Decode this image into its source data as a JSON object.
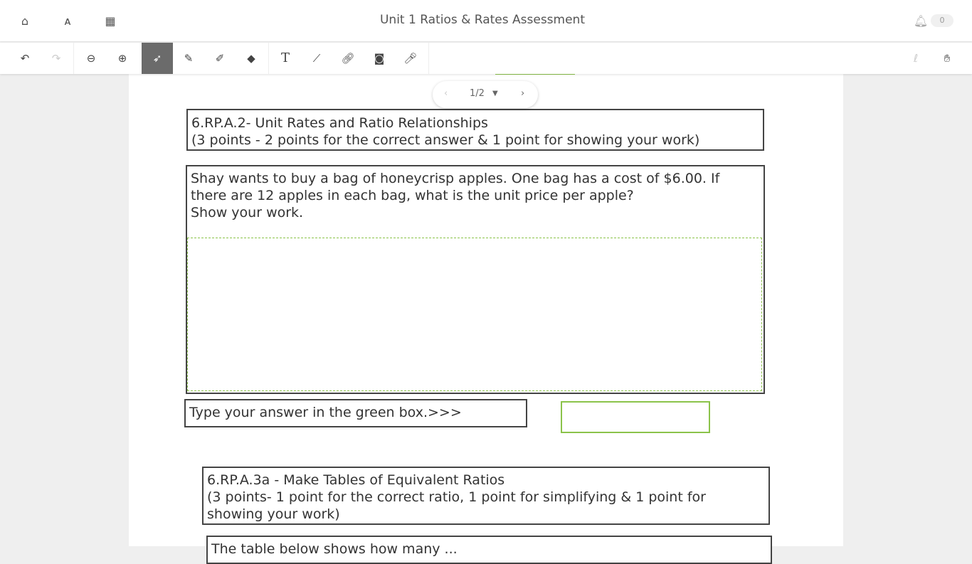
{
  "header": {
    "title": "Unit 1 Ratios & Rates Assessment",
    "notification_count": "0"
  },
  "toolbar": {
    "tools": [
      "undo",
      "redo",
      "zoom-out",
      "zoom-in",
      "select",
      "pen",
      "highlighter",
      "eraser",
      "text",
      "line",
      "link",
      "camera",
      "microphone"
    ],
    "active_tool": "select"
  },
  "pager": {
    "label": "1/2"
  },
  "content": {
    "q1_title": "6.RP.A.2- Unit Rates and Ratio Relationships",
    "q1_points": "(3 points - 2 points for the correct answer & 1 point for showing your work)",
    "q1_text": "Shay wants to buy a bag of honeycrisp apples.  One bag has a cost of $6.00.  If there are 12 apples in each bag, what is the unit price per apple?",
    "q1_show": "Show your work.",
    "answer_prompt": "Type your answer in the green box.>>>",
    "answer_value": "",
    "q2_title": "6.RP.A.3a - Make Tables of Equivalent Ratios",
    "q2_points": "(3 points- 1 point for the correct ratio, 1 point for simplifying & 1 point for showing your work)",
    "q2_text": "The table below shows how many ..."
  },
  "colors": {
    "accent_green": "#8bc34a",
    "title_blue": "#3b3bd6",
    "active_tool": "#6b6b6b"
  }
}
